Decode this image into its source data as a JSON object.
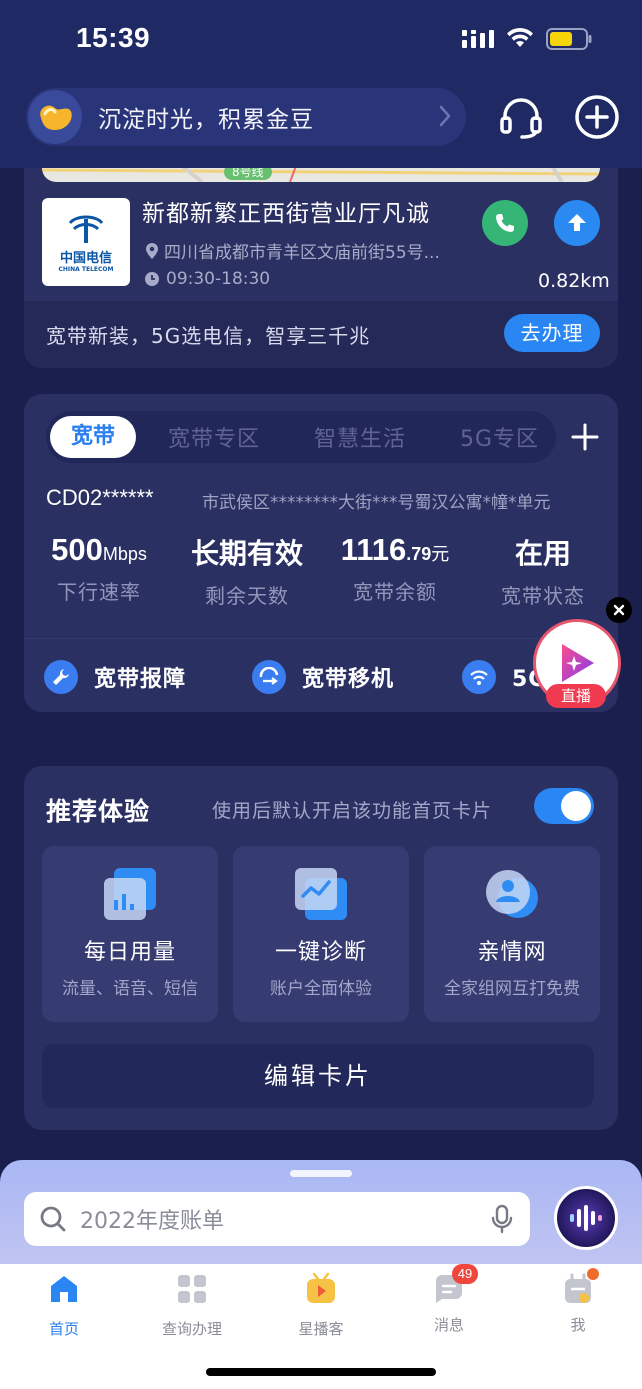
{
  "status_bar": {
    "time": "15:39"
  },
  "header": {
    "promo_text": "沉淀时光，积累金豆"
  },
  "store": {
    "map_line_label": "8号线",
    "logo_cn": "中国电信",
    "logo_en": "CHINA TELECOM",
    "name": "新都新繁正西街营业厅凡诚",
    "address": "四川省成都市青羊区文庙前街55号...",
    "hours": "09:30-18:30",
    "distance": "0.82km",
    "promo_text": "宽带新装，5G选电信，智享三千兆",
    "action_label": "去办理"
  },
  "broadband": {
    "tabs": [
      "宽带",
      "宽带专区",
      "智慧生活",
      "5G专区"
    ],
    "active_tab": "宽带",
    "account": "CD02******",
    "address": "市武侯区********大街***号蜀汉公寓*幢*单元",
    "stats": [
      {
        "value": "500",
        "unit": "Mbps",
        "label": "下行速率"
      },
      {
        "value": "长期有效",
        "unit": "",
        "label": "剩余天数"
      },
      {
        "value": "1116",
        "decimal": ".79",
        "unit": "元",
        "label": "宽带余额"
      },
      {
        "value": "在用",
        "unit": "",
        "label": "宽带状态"
      }
    ],
    "actions": [
      "宽带报障",
      "宽带移机",
      "5G套餐"
    ]
  },
  "live": {
    "badge": "直播"
  },
  "recommend": {
    "title": "推荐体验",
    "hint": "使用后默认开启该功能首页卡片",
    "toggle_on": true,
    "items": [
      {
        "name": "每日用量",
        "desc": "流量、语音、短信",
        "icon": "bar-chart-icon"
      },
      {
        "name": "一键诊断",
        "desc": "账户全面体验",
        "icon": "line-chart-icon"
      },
      {
        "name": "亲情网",
        "desc": "全家组网互打免费",
        "icon": "person-icon"
      }
    ],
    "edit_label": "编辑卡片"
  },
  "search": {
    "placeholder": "2022年度账单"
  },
  "tabbar": {
    "items": [
      {
        "label": "首页",
        "active": true
      },
      {
        "label": "查询办理",
        "active": false
      },
      {
        "label": "星播客",
        "active": false
      },
      {
        "label": "消息",
        "active": false,
        "badge": "49"
      },
      {
        "label": "我",
        "active": false
      }
    ]
  },
  "colors": {
    "accent": "#2a86f2",
    "background": "#1a1f4e",
    "card": "#2b3062"
  }
}
